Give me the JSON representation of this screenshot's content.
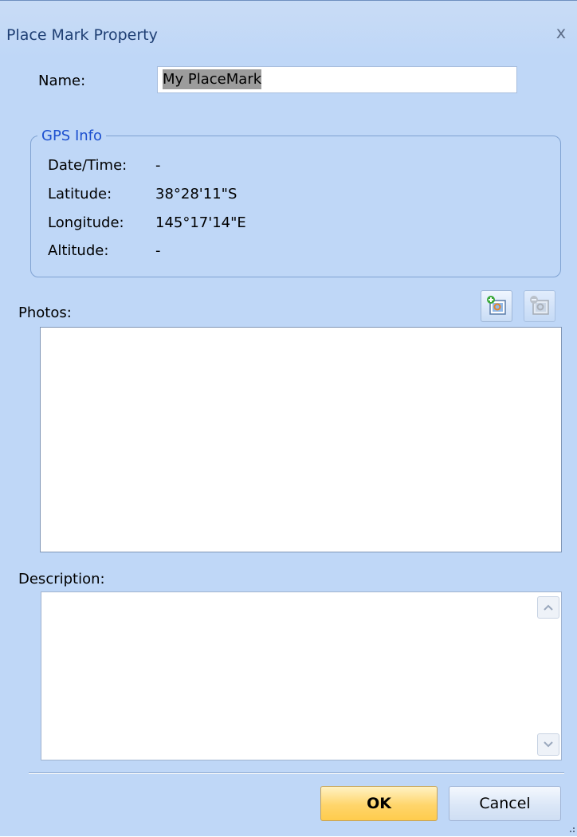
{
  "window": {
    "title": "Place Mark Property",
    "close_glyph": "x"
  },
  "name": {
    "label": "Name:",
    "value": "My PlaceMark"
  },
  "gps": {
    "legend": "GPS Info",
    "rows": [
      {
        "label": "Date/Time:",
        "value": "-"
      },
      {
        "label": "Latitude:",
        "value": "38°28'11\"S"
      },
      {
        "label": "Longitude:",
        "value": "145°17'14\"E"
      },
      {
        "label": "Altitude:",
        "value": "-"
      }
    ]
  },
  "photos": {
    "label": "Photos:",
    "add_icon": "add-photo-icon",
    "remove_icon": "remove-photo-icon"
  },
  "description": {
    "label": "Description:",
    "value": ""
  },
  "buttons": {
    "ok": "OK",
    "cancel": "Cancel"
  },
  "colors": {
    "dialog_bg": "#bfd7f7",
    "legend_text": "#1c4fcf",
    "ok_button": "#ffd56b"
  }
}
